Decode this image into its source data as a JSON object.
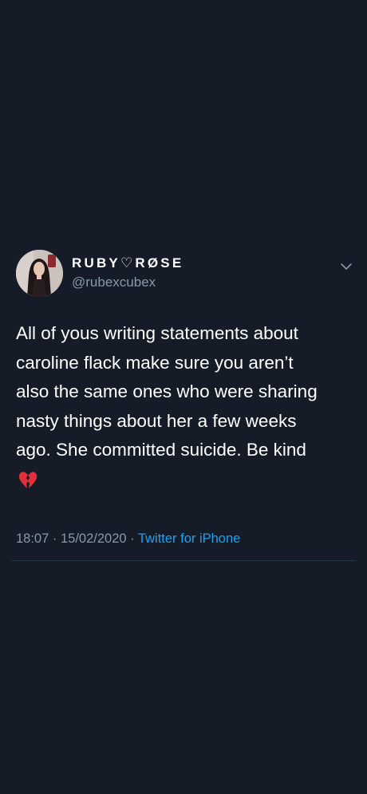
{
  "tweet": {
    "author": {
      "display_name": "RUBY♡RØSE",
      "handle": "@rubexcubex",
      "avatar_icon": "profile-photo"
    },
    "body_lines": [
      "All of yous writing statements about",
      "caroline flack make sure you aren’t",
      "also the same ones who were sharing",
      "nasty things about her a few weeks",
      "ago. She committed suicide. Be kind"
    ],
    "emoji": "broken-heart-icon",
    "time": "18:07",
    "date": "15/02/2020",
    "separator": " · ",
    "source": "Twitter for iPhone"
  },
  "colors": {
    "background": "#151c28",
    "text_primary": "#ffffff",
    "text_secondary": "#8899a6",
    "link": "#1da1f2",
    "divider": "#263442",
    "emoji": "#e0303a"
  }
}
